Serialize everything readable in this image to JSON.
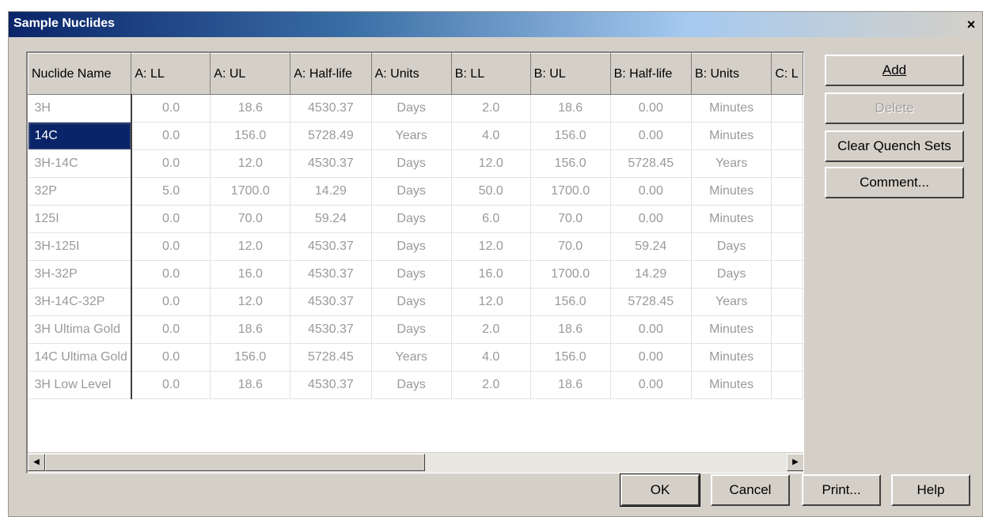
{
  "window": {
    "title": "Sample Nuclides",
    "close_label": "×"
  },
  "table": {
    "columns": [
      "Nuclide Name",
      "A: LL",
      "A: UL",
      "A: Half-life",
      "A: Units",
      "B: LL",
      "B: UL",
      "B: Half-life",
      "B: Units",
      "C: L"
    ],
    "rows": [
      [
        "3H",
        "0.0",
        "18.6",
        "4530.37",
        "Days",
        "2.0",
        "18.6",
        "0.00",
        "Minutes",
        ""
      ],
      [
        "14C",
        "0.0",
        "156.0",
        "5728.49",
        "Years",
        "4.0",
        "156.0",
        "0.00",
        "Minutes",
        ""
      ],
      [
        "3H-14C",
        "0.0",
        "12.0",
        "4530.37",
        "Days",
        "12.0",
        "156.0",
        "5728.45",
        "Years",
        ""
      ],
      [
        "32P",
        "5.0",
        "1700.0",
        "14.29",
        "Days",
        "50.0",
        "1700.0",
        "0.00",
        "Minutes",
        ""
      ],
      [
        "125I",
        "0.0",
        "70.0",
        "59.24",
        "Days",
        "6.0",
        "70.0",
        "0.00",
        "Minutes",
        ""
      ],
      [
        "3H-125I",
        "0.0",
        "12.0",
        "4530.37",
        "Days",
        "12.0",
        "70.0",
        "59.24",
        "Days",
        ""
      ],
      [
        "3H-32P",
        "0.0",
        "16.0",
        "4530.37",
        "Days",
        "16.0",
        "1700.0",
        "14.29",
        "Days",
        ""
      ],
      [
        "3H-14C-32P",
        "0.0",
        "12.0",
        "4530.37",
        "Days",
        "12.0",
        "156.0",
        "5728.45",
        "Years",
        ""
      ],
      [
        "3H Ultima Gold",
        "0.0",
        "18.6",
        "4530.37",
        "Days",
        "2.0",
        "18.6",
        "0.00",
        "Minutes",
        ""
      ],
      [
        "14C Ultima Gold",
        "0.0",
        "156.0",
        "5728.45",
        "Years",
        "4.0",
        "156.0",
        "0.00",
        "Minutes",
        ""
      ],
      [
        "3H Low Level",
        "0.0",
        "18.6",
        "4530.37",
        "Days",
        "2.0",
        "18.6",
        "0.00",
        "Minutes",
        ""
      ]
    ],
    "selected_row": 1
  },
  "scrollbar": {
    "left_arrow": "◀",
    "right_arrow": "▶"
  },
  "buttons": {
    "add": "Add",
    "delete": "Delete",
    "clear_quench": "Clear Quench Sets",
    "comment": "Comment...",
    "ok": "OK",
    "cancel": "Cancel",
    "print": "Print...",
    "help": "Help"
  }
}
